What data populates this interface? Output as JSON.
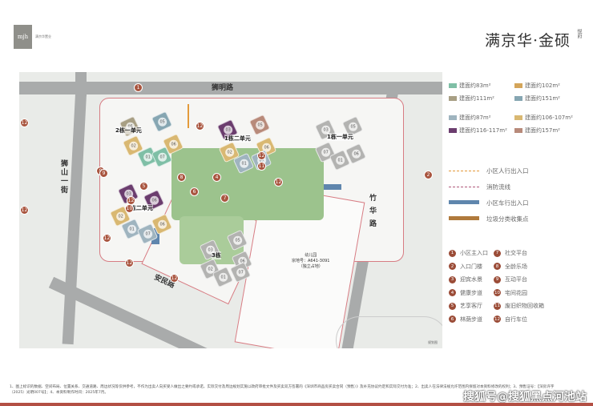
{
  "header": {
    "logo_mark": "mjh",
    "logo_sub": "满京华置业",
    "brand_title": "满京华·金硕",
    "brand_side": "悦府"
  },
  "map": {
    "roads": {
      "north": "狮明路",
      "west": "狮山一街",
      "east": "竹华路",
      "south": "安民路"
    },
    "kindergarten": {
      "title": "幼儿园",
      "sub": "宗地号：A641-3091",
      "sub2": "（独立占地）"
    },
    "corner_note": "规划图",
    "buildings": [
      {
        "name": "2栋一单元",
        "units": [
          {
            "label": "05",
            "type": "t111"
          },
          {
            "label": "05",
            "type": "t151"
          },
          {
            "label": "02",
            "type": "t106"
          },
          {
            "label": "01",
            "type": "t83"
          },
          {
            "label": "06",
            "type": "t106"
          },
          {
            "label": "07",
            "type": "t83"
          }
        ]
      },
      {
        "name": "1栋二单元",
        "units": [
          {
            "label": "03",
            "type": "t116"
          },
          {
            "label": "05",
            "type": "t157"
          },
          {
            "label": "02",
            "type": "t106"
          },
          {
            "label": "01",
            "type": "t87"
          },
          {
            "label": "06",
            "type": "t106"
          },
          {
            "label": "07",
            "type": "t87"
          }
        ]
      },
      {
        "name": "1栋一单元",
        "units": [
          {
            "label": "03",
            "type": "gray"
          },
          {
            "label": "05",
            "type": "gray"
          },
          {
            "label": "07",
            "type": "gray"
          },
          {
            "label": "01",
            "type": "gray"
          },
          {
            "label": "06",
            "type": "gray"
          }
        ]
      },
      {
        "name": "2栋二单元",
        "units": [
          {
            "label": "03",
            "type": "t116"
          },
          {
            "label": "06",
            "type": "t116"
          },
          {
            "label": "02",
            "type": "t106"
          },
          {
            "label": "01",
            "type": "t87"
          },
          {
            "label": "07",
            "type": "t87"
          },
          {
            "label": "06",
            "type": "t106"
          }
        ]
      },
      {
        "name": "3栋",
        "units": [
          {
            "label": "05",
            "type": "gray"
          },
          {
            "label": "03",
            "type": "gray"
          },
          {
            "label": "06",
            "type": "gray"
          },
          {
            "label": "02",
            "type": "gray"
          },
          {
            "label": "01",
            "type": "gray"
          },
          {
            "label": "07",
            "type": "gray"
          }
        ]
      }
    ],
    "markers": [
      "1",
      "2",
      "4",
      "5",
      "6",
      "7",
      "8",
      "9",
      "9",
      "10",
      "11",
      "12",
      "12",
      "12",
      "12",
      "12",
      "12",
      "12",
      "12",
      "12"
    ]
  },
  "colors": {
    "t83": "#7fbfa6",
    "t102": "#d4a55a",
    "t111": "#a89f84",
    "t151": "#86a6b2",
    "t87": "#9fb4bf",
    "t106": "#d9b872",
    "t116": "#6b3d6e",
    "t157": "#b88a7a",
    "gray": "#b3b3b1",
    "pedestrian": "#e39a3a",
    "fire": "#b0587a",
    "vehicle": "#5f86ad",
    "trash": "#b07a3c",
    "marker": "#9b4c37"
  },
  "legend": {
    "unit_types": [
      {
        "label": "建面约83m²",
        "color": "#7fbfa6"
      },
      {
        "label": "建面约102m²",
        "color": "#d4a55a"
      },
      {
        "label": "建面约111m²",
        "color": "#a89f84"
      },
      {
        "label": "建面约151m²",
        "color": "#86a6b2"
      },
      {
        "label": "建面约87m²",
        "color": "#9fb4bf"
      },
      {
        "label": "建面约106-107m²",
        "color": "#d9b872"
      },
      {
        "label": "建面约116-117m²",
        "color": "#6b3d6e"
      },
      {
        "label": "建面约157m²",
        "color": "#b88a7a"
      }
    ],
    "lines": [
      "小区人行出入口",
      "消防流线",
      "小区车行出入口",
      "垃圾分类收集点"
    ],
    "facilities": [
      {
        "n": "1",
        "label": "小区主入口"
      },
      {
        "n": "7",
        "label": "社交平台"
      },
      {
        "n": "2",
        "label": "入口门楼"
      },
      {
        "n": "8",
        "label": "全龄乐场"
      },
      {
        "n": "3",
        "label": "迎宾水景"
      },
      {
        "n": "9",
        "label": "互动平台"
      },
      {
        "n": "4",
        "label": "健康步道"
      },
      {
        "n": "10",
        "label": "宅间花园"
      },
      {
        "n": "5",
        "label": "艺享客厅"
      },
      {
        "n": "11",
        "label": "废旧织物回收箱"
      },
      {
        "n": "6",
        "label": "林荫步道"
      },
      {
        "n": "12",
        "label": "自行车位"
      }
    ]
  },
  "footnote": "1、图上标识的数据、空间布局、位置关系、交通道路、周边状况等仅供参考，不作为出卖人向买受人做出之要约或承诺，实际交付及周边规划实施以政府审批文件及买卖双方签署的《深圳市商品房买卖合同（预售）》及补充协议约定和实际交付为准；2、出卖人在法律法规允许范围内保留对本资料修改的权利；3、预售证号：【深房许字（2025）光明007号】；4、本资料制作时间：2025年7月。",
  "watermark": "搜狐号@搜狐黑点河池站"
}
